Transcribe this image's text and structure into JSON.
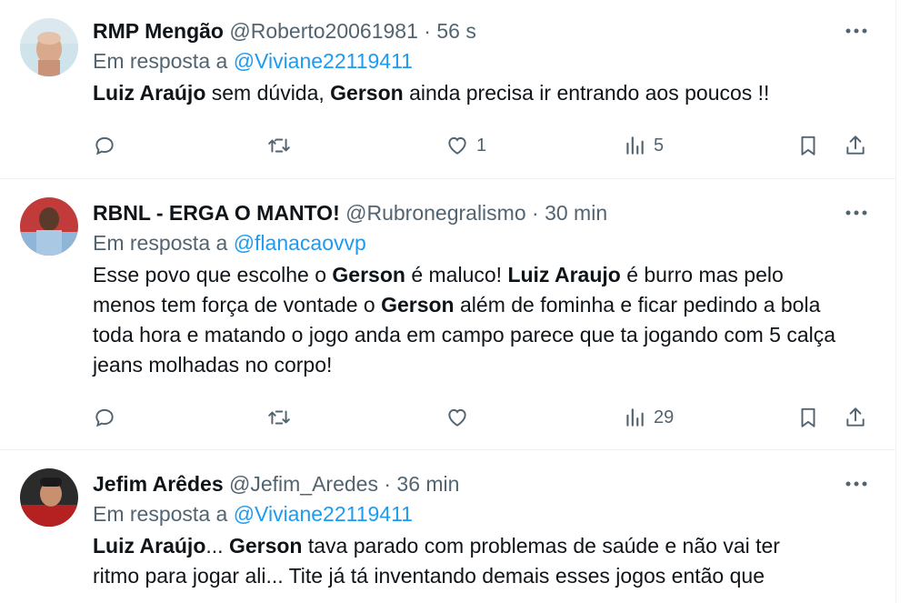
{
  "tweets": [
    {
      "name": "RMP Mengão",
      "handle": "@Roberto20061981",
      "sep": "·",
      "time": "56 s",
      "reply_prefix": "Em resposta a",
      "reply_to": "@Viviane22119411",
      "text": [
        {
          "t": "Luiz Araújo",
          "b": true
        },
        {
          "t": " sem dúvida, ",
          "b": false
        },
        {
          "t": "Gerson",
          "b": true
        },
        {
          "t": " ainda precisa ir entrando aos poucos !!",
          "b": false
        }
      ],
      "stats": {
        "replies": "",
        "retweets": "",
        "likes": "1",
        "views": "5"
      }
    },
    {
      "name": "RBNL - ERGA O MANTO!",
      "handle": "@Rubronegralismo",
      "sep": "·",
      "time": "30 min",
      "reply_prefix": "Em resposta a",
      "reply_to": "@flanacaovvp",
      "text": [
        {
          "t": "Esse povo que escolhe o ",
          "b": false
        },
        {
          "t": "Gerson",
          "b": true
        },
        {
          "t": " é maluco! ",
          "b": false
        },
        {
          "t": "Luiz Araujo",
          "b": true
        },
        {
          "t": " é burro mas pelo menos tem força de vontade o ",
          "b": false
        },
        {
          "t": "Gerson",
          "b": true
        },
        {
          "t": " além de fominha e ficar pedindo a bola toda hora e matando o jogo anda em campo parece que ta jogando com 5 calça jeans molhadas no corpo!",
          "b": false
        }
      ],
      "stats": {
        "replies": "",
        "retweets": "",
        "likes": "",
        "views": "29"
      }
    },
    {
      "name": "Jefim Arêdes",
      "handle": "@Jefim_Aredes",
      "sep": "·",
      "time": "36 min",
      "reply_prefix": "Em resposta a",
      "reply_to": "@Viviane22119411",
      "text": [
        {
          "t": "Luiz Araújo",
          "b": true
        },
        {
          "t": "... ",
          "b": false
        },
        {
          "t": "Gerson",
          "b": true
        },
        {
          "t": " tava parado com problemas de saúde e não vai ter ritmo para jogar ali... Tite já tá inventando demais esses jogos então que",
          "b": false
        }
      ],
      "stats": {
        "replies": "",
        "retweets": "",
        "likes": "",
        "views": ""
      }
    }
  ],
  "icons": {
    "more": "more-dots-icon",
    "reply": "reply-bubble-icon",
    "retweet": "retweet-icon",
    "like": "heart-icon",
    "views": "views-bar-chart-icon",
    "bookmark": "bookmark-icon",
    "share": "share-upload-icon"
  },
  "colors": {
    "link": "#1d9bf0",
    "muted": "#536471",
    "text": "#0f1419",
    "border": "#eff3f4"
  }
}
